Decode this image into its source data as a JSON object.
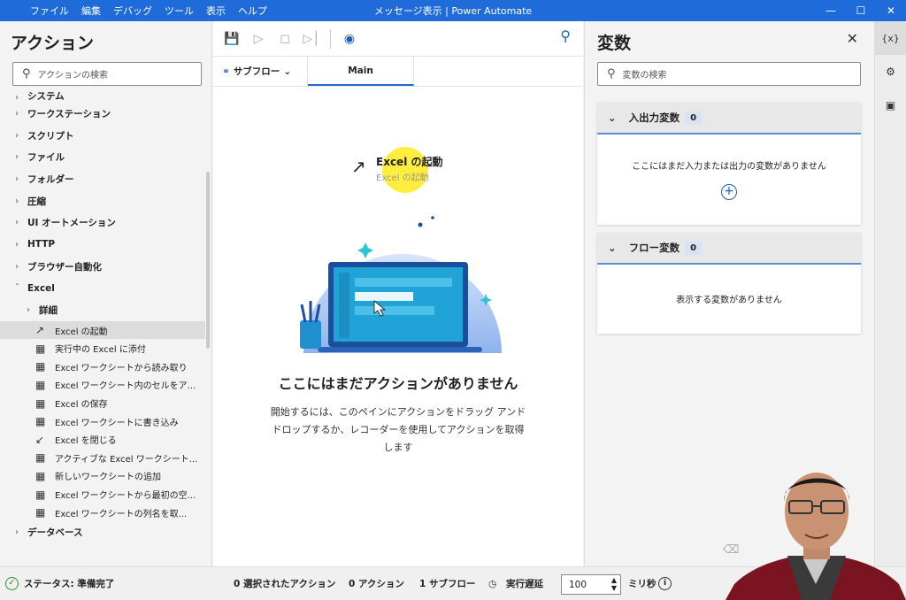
{
  "window": {
    "title": "メッセージ表示 | Power Automate",
    "menu": [
      "ファイル",
      "編集",
      "デバッグ",
      "ツール",
      "表示",
      "ヘルプ"
    ]
  },
  "actions_pane": {
    "title": "アクション",
    "search_placeholder": "アクションの検索",
    "groups": [
      {
        "label": "システム"
      },
      {
        "label": "ワークステーション"
      },
      {
        "label": "スクリプト"
      },
      {
        "label": "ファイル"
      },
      {
        "label": "フォルダー"
      },
      {
        "label": "圧縮"
      },
      {
        "label": "UI オートメーション"
      },
      {
        "label": "HTTP"
      },
      {
        "label": "ブラウザー自動化"
      },
      {
        "label": "Excel"
      }
    ],
    "excel_sub": "詳細",
    "excel_actions": [
      {
        "label": "Excel の起動",
        "icon": "launch-arrow-icon"
      },
      {
        "label": "実行中の Excel に添付",
        "icon": "excel-icon"
      },
      {
        "label": "Excel ワークシートから読み取り",
        "icon": "excel-icon"
      },
      {
        "label": "Excel ワークシート内のセルをア...",
        "icon": "excel-icon"
      },
      {
        "label": "Excel の保存",
        "icon": "excel-icon"
      },
      {
        "label": "Excel ワークシートに書き込み",
        "icon": "excel-icon"
      },
      {
        "label": "Excel を閉じる",
        "icon": "close-arrow-icon"
      },
      {
        "label": "アクティブな Excel ワークシート...",
        "icon": "excel-icon"
      },
      {
        "label": "新しいワークシートの追加",
        "icon": "excel-icon"
      },
      {
        "label": "Excel ワークシートから最初の空...",
        "icon": "excel-icon"
      },
      {
        "label": "Excel ワークシートの列名を取...",
        "icon": "excel-icon"
      }
    ],
    "after_group": "データベース"
  },
  "designer": {
    "subflow_label": "サブフロー",
    "main_tab": "Main",
    "drag_title": "Excel の起動",
    "drag_sub": "Excel の起動",
    "empty_title": "ここにはまだアクションがありません",
    "empty_desc": "開始するには、このペインにアクションをドラッグ アンド ドロップするか、レコーダーを使用してアクションを取得します"
  },
  "variables_pane": {
    "title": "変数",
    "search_placeholder": "変数の検索",
    "io_group": {
      "label": "入出力変数",
      "count": "0",
      "empty": "ここにはまだ入力または出力の変数がありません"
    },
    "flow_group": {
      "label": "フロー変数",
      "count": "0",
      "empty": "表示する変数がありません"
    },
    "rail": [
      "{x}",
      "layers-icon",
      "image-icon"
    ]
  },
  "status": {
    "ready": "ステータス: 準備完了",
    "selected": "0 選択されたアクション",
    "actions": "0 アクション",
    "subflows": "1 サブフロー",
    "delay_label": "実行遅延",
    "delay_value": "100",
    "unit": "ミリ秒"
  },
  "colors": {
    "accent": "#1e6bd9",
    "highlight": "#ffe800",
    "laptop": "#1f8fd0"
  }
}
